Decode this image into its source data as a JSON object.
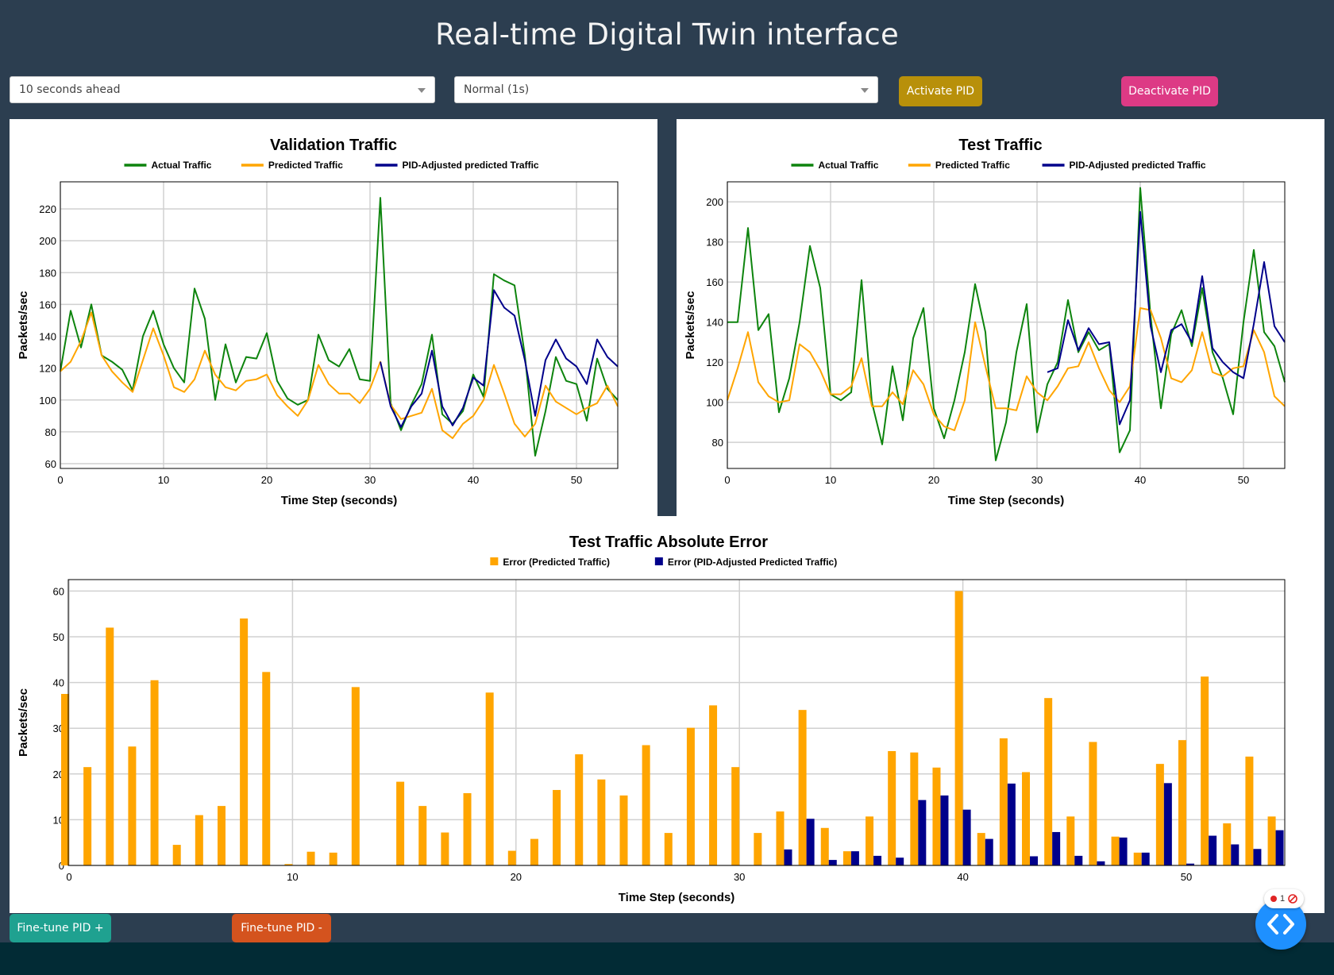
{
  "page": {
    "title": "Real-time Digital Twin interface"
  },
  "controls": {
    "horizon_select": "10 seconds ahead",
    "speed_select": "Normal (1s)",
    "activate_label": "Activate PID",
    "deactivate_label": "Deactivate PID",
    "finetune_plus_label": "Fine-tune PID +",
    "finetune_minus_label": "Fine-tune PID -"
  },
  "colors": {
    "actual": "#0d840d",
    "predicted": "#ffa500",
    "pid": "#00008b",
    "activate_btn": "#b8900a",
    "deactivate_btn": "#dd3a85",
    "finetune_plus_btn": "#1fa190",
    "finetune_minus_btn": "#d4531e"
  },
  "widget": {
    "badge_count": "1"
  },
  "chart_data": [
    {
      "type": "line",
      "title": "Validation Traffic",
      "xlabel": "Time Step (seconds)",
      "ylabel": "Packets/sec",
      "xlim": [
        0,
        54
      ],
      "ylim": [
        57,
        237
      ],
      "xticks": [
        0,
        10,
        20,
        30,
        40,
        50
      ],
      "yticks": [
        60,
        80,
        100,
        120,
        140,
        160,
        180,
        200,
        220
      ],
      "grid": true,
      "legend": "top-center",
      "series": [
        {
          "name": "Actual Traffic",
          "color": "#0d840d",
          "x": [
            0,
            1,
            2,
            3,
            4,
            5,
            6,
            7,
            8,
            9,
            10,
            11,
            12,
            13,
            14,
            15,
            16,
            17,
            18,
            19,
            20,
            21,
            22,
            23,
            24,
            25,
            26,
            27,
            28,
            29,
            30,
            31,
            32,
            33,
            34,
            35,
            36,
            37,
            38,
            39,
            40,
            41,
            42,
            43,
            44,
            45,
            46,
            47,
            48,
            49,
            50,
            51,
            52,
            53,
            54
          ],
          "values": [
            118,
            156,
            133,
            160,
            128,
            124,
            119,
            106,
            140,
            156,
            135,
            120,
            111,
            170,
            151,
            100,
            135,
            111,
            127,
            126,
            142,
            112,
            101,
            97,
            100,
            141,
            125,
            121,
            132,
            113,
            112,
            227,
            98,
            81,
            97,
            110,
            141,
            91,
            85,
            93,
            116,
            102,
            179,
            175,
            172,
            128,
            65,
            93,
            127,
            112,
            110,
            87,
            126,
            107,
            100
          ]
        },
        {
          "name": "Predicted Traffic",
          "color": "#ffa500",
          "x": [
            0,
            1,
            2,
            3,
            4,
            5,
            6,
            7,
            8,
            9,
            10,
            11,
            12,
            13,
            14,
            15,
            16,
            17,
            18,
            19,
            20,
            21,
            22,
            23,
            24,
            25,
            26,
            27,
            28,
            29,
            30,
            31,
            32,
            33,
            34,
            35,
            36,
            37,
            38,
            39,
            40,
            41,
            42,
            43,
            44,
            45,
            46,
            47,
            48,
            49,
            50,
            51,
            52,
            53,
            54
          ],
          "values": [
            118,
            124,
            137,
            155,
            128,
            118,
            111,
            105,
            125,
            145,
            128,
            108,
            105,
            113,
            131,
            116,
            108,
            106,
            112,
            113,
            116,
            103,
            96,
            90,
            100,
            122,
            110,
            104,
            104,
            98,
            107,
            124,
            97,
            88,
            90,
            92,
            107,
            81,
            76,
            85,
            90,
            100,
            122,
            104,
            85,
            77,
            85,
            109,
            99,
            95,
            91,
            95,
            98,
            109,
            96
          ]
        },
        {
          "name": "PID-Adjusted predicted Traffic",
          "color": "#00008b",
          "x": [
            31,
            32,
            33,
            34,
            35,
            36,
            37,
            38,
            39,
            40,
            41,
            42,
            43,
            44,
            45,
            46,
            47,
            48,
            49,
            50,
            51,
            52,
            53,
            54
          ],
          "values": [
            124,
            96,
            83,
            96,
            104,
            131,
            96,
            84,
            95,
            114,
            109,
            169,
            158,
            153,
            125,
            90,
            125,
            138,
            126,
            121,
            110,
            138,
            127,
            121
          ]
        }
      ]
    },
    {
      "type": "line",
      "title": "Test Traffic",
      "xlabel": "Time Step (seconds)",
      "ylabel": "Packets/sec",
      "xlim": [
        0,
        54
      ],
      "ylim": [
        67,
        210
      ],
      "xticks": [
        0,
        10,
        20,
        30,
        40,
        50
      ],
      "yticks": [
        80,
        100,
        120,
        140,
        160,
        180,
        200
      ],
      "grid": true,
      "legend": "top-center",
      "series": [
        {
          "name": "Actual Traffic",
          "color": "#0d840d",
          "x": [
            0,
            1,
            2,
            3,
            4,
            5,
            6,
            7,
            8,
            9,
            10,
            11,
            12,
            13,
            14,
            15,
            16,
            17,
            18,
            19,
            20,
            21,
            22,
            23,
            24,
            25,
            26,
            27,
            28,
            29,
            30,
            31,
            32,
            33,
            34,
            35,
            36,
            37,
            38,
            39,
            40,
            41,
            42,
            43,
            44,
            45,
            46,
            47,
            48,
            49,
            50,
            51,
            52,
            53,
            54
          ],
          "values": [
            140,
            140,
            187,
            136,
            144,
            95,
            112,
            140,
            178,
            157,
            104,
            101,
            105,
            161,
            100,
            79,
            118,
            91,
            132,
            147,
            97,
            82,
            101,
            125,
            159,
            135,
            71,
            90,
            125,
            149,
            85,
            109,
            120,
            151,
            125,
            135,
            126,
            129,
            75,
            86,
            207,
            143,
            97,
            134,
            146,
            128,
            157,
            125,
            112,
            94,
            140,
            176,
            135,
            128,
            110
          ]
        },
        {
          "name": "Predicted Traffic",
          "color": "#ffa500",
          "x": [
            0,
            1,
            2,
            3,
            4,
            5,
            6,
            7,
            8,
            9,
            10,
            11,
            12,
            13,
            14,
            15,
            16,
            17,
            18,
            19,
            20,
            21,
            22,
            23,
            24,
            25,
            26,
            27,
            28,
            29,
            30,
            31,
            32,
            33,
            34,
            35,
            36,
            37,
            38,
            39,
            40,
            41,
            42,
            43,
            44,
            45,
            46,
            47,
            48,
            49,
            50,
            51,
            52,
            53,
            54
          ],
          "values": [
            101,
            117,
            135,
            110,
            103,
            100,
            101,
            129,
            125,
            116,
            104,
            104,
            108,
            122,
            98,
            98,
            105,
            99,
            116,
            109,
            94,
            88,
            86,
            101,
            140,
            118,
            97,
            97,
            96,
            113,
            105,
            101,
            108,
            117,
            118,
            130,
            117,
            106,
            100,
            108,
            147,
            146,
            132,
            112,
            110,
            116,
            135,
            115,
            113,
            117,
            118,
            136,
            125,
            103,
            98
          ]
        },
        {
          "name": "PID-Adjusted predicted Traffic",
          "color": "#00008b",
          "x": [
            31,
            32,
            33,
            34,
            35,
            36,
            37,
            38,
            39,
            40,
            41,
            42,
            43,
            44,
            45,
            46,
            47,
            48,
            49,
            50,
            51,
            52,
            53,
            54
          ],
          "values": [
            115,
            117,
            141,
            126,
            137,
            129,
            130,
            89,
            101,
            195,
            138,
            115,
            136,
            139,
            130,
            163,
            127,
            120,
            115,
            112,
            139,
            170,
            138,
            130
          ]
        }
      ]
    },
    {
      "type": "bar",
      "title": "Test Traffic Absolute Error",
      "xlabel": "Time Step (seconds)",
      "ylabel": "Packets/sec",
      "xlim": [
        0,
        54
      ],
      "ylim": [
        0,
        62.5
      ],
      "xticks": [
        0,
        10,
        20,
        30,
        40,
        50
      ],
      "yticks": [
        0,
        10,
        20,
        30,
        40,
        50,
        60
      ],
      "grid": true,
      "legend": "top-center",
      "x": [
        0,
        1,
        2,
        3,
        4,
        5,
        6,
        7,
        8,
        9,
        10,
        11,
        12,
        13,
        14,
        15,
        16,
        17,
        18,
        19,
        20,
        21,
        22,
        23,
        24,
        25,
        26,
        27,
        28,
        29,
        30,
        31,
        32,
        33,
        34,
        35,
        36,
        37,
        38,
        39,
        40,
        41,
        42,
        43,
        44,
        45,
        46,
        47,
        48,
        49,
        50,
        51,
        52,
        53,
        54
      ],
      "series": [
        {
          "name": "Error (Predicted Traffic)",
          "color": "#ffa500",
          "values": [
            37.5,
            21.5,
            52,
            26,
            40.5,
            4.5,
            11,
            13,
            54,
            42.3,
            0.3,
            3,
            2.8,
            39,
            0,
            18.3,
            13,
            7.2,
            15.8,
            37.8,
            3.2,
            5.8,
            16.5,
            24.3,
            18.8,
            15.3,
            26.3,
            7.1,
            30.1,
            35,
            21.5,
            7.1,
            11.8,
            34,
            8.2,
            3.1,
            10.7,
            25,
            24.7,
            21.4,
            60,
            7.1,
            27.8,
            20.4,
            36.6,
            10.7,
            27,
            6.3,
            2.8,
            22.2,
            27.4,
            41.3,
            9.2,
            23.8,
            10.7
          ]
        },
        {
          "name": "Error (PID-Adjusted Predicted Traffic)",
          "color": "#00008b",
          "values": [
            0,
            0,
            0,
            0,
            0,
            0,
            0,
            0,
            0,
            0,
            0,
            0,
            0,
            0,
            0,
            0,
            0,
            0,
            0,
            0,
            0,
            0,
            0,
            0,
            0,
            0,
            0,
            0,
            0,
            0,
            0,
            0,
            3.5,
            10.2,
            1.2,
            3.1,
            2.1,
            1.7,
            14.3,
            15.3,
            12.2,
            5.8,
            17.9,
            2,
            7.3,
            2.1,
            0.9,
            6.1,
            2.8,
            18,
            0.4,
            6.5,
            4.6,
            3.6,
            7.7
          ]
        }
      ]
    }
  ]
}
